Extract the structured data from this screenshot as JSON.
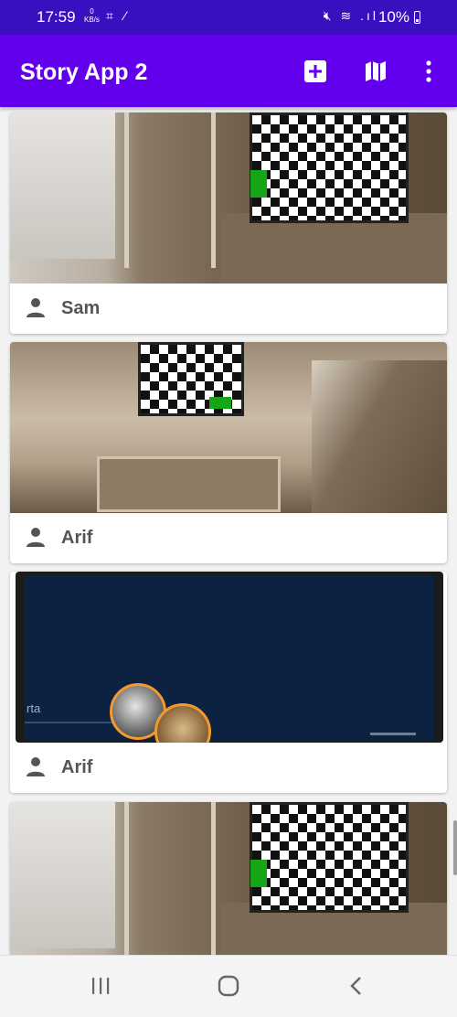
{
  "status_bar": {
    "time": "17:59",
    "speed_value": "0",
    "speed_unit": "KB/s",
    "battery": "10%"
  },
  "app_bar": {
    "title": "Story App 2",
    "actions": [
      "add-icon",
      "map-icon",
      "more-vert-icon"
    ]
  },
  "stories": [
    {
      "name": "Sam",
      "image": "living-room-checkerboard-tv"
    },
    {
      "name": "Arif",
      "image": "ceiling-checkerboard-shelves"
    },
    {
      "name": "Arif",
      "image": "dark-map-screen-markers"
    },
    {
      "name": "",
      "image": "living-room-checkerboard-tv"
    }
  ],
  "map_text": {
    "label": "rta"
  },
  "nav_bar": {
    "buttons": [
      "recents-icon",
      "home-icon",
      "back-icon"
    ]
  },
  "colors": {
    "status_bar": "#3a0fbf",
    "app_bar": "#6200ee",
    "background": "#f2f2f2"
  }
}
